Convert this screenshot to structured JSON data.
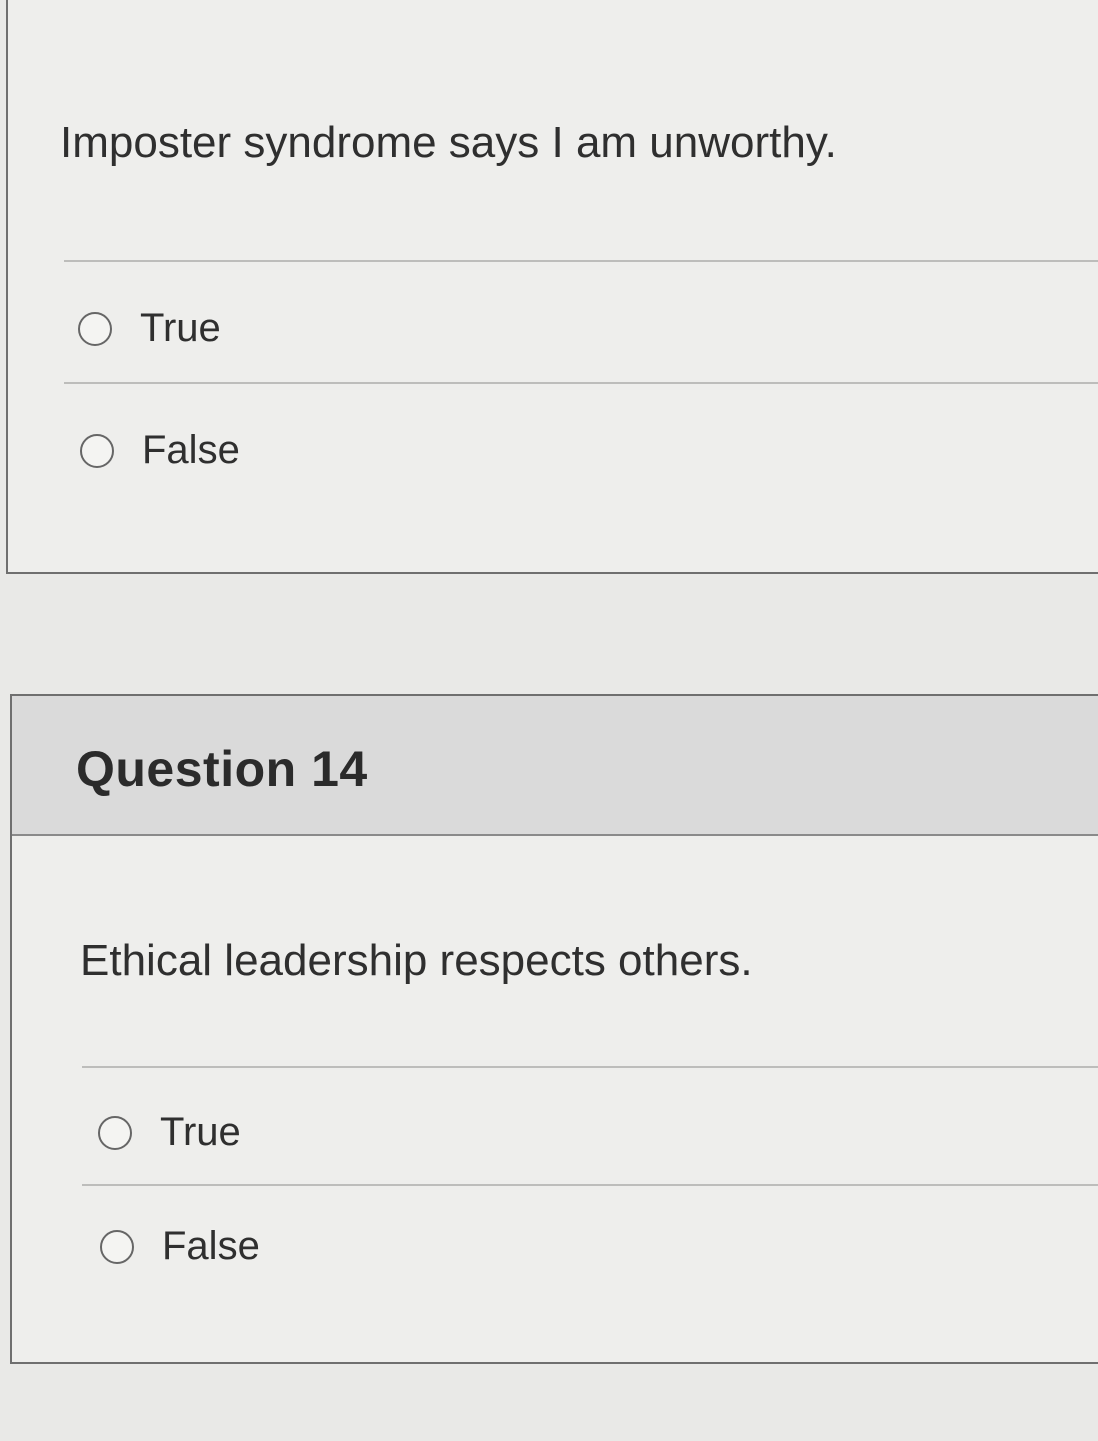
{
  "question_13": {
    "text": "Imposter syndrome says I am unworthy.",
    "options": [
      {
        "label": "True",
        "selected": false
      },
      {
        "label": "False",
        "selected": false
      }
    ]
  },
  "question_14": {
    "title": "Question 14",
    "text": "Ethical leadership respects others.",
    "options": [
      {
        "label": "True",
        "selected": false
      },
      {
        "label": "False",
        "selected": false
      }
    ]
  }
}
